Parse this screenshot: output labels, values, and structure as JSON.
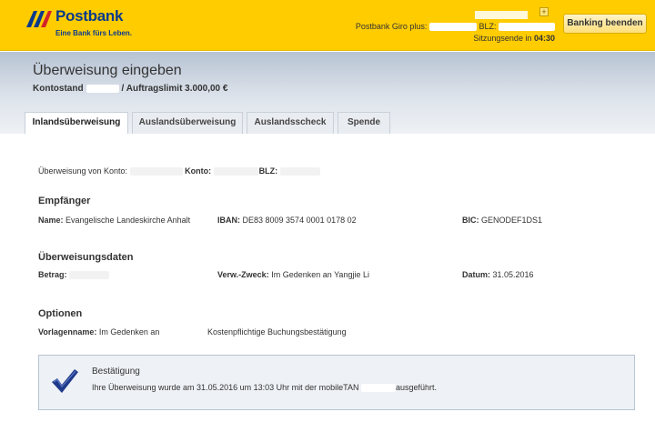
{
  "header": {
    "brand": "Postbank",
    "claim": "Eine Bank fürs Leben.",
    "account_label": "Postbank Giro plus:",
    "blz_label": "BLZ:",
    "session_label": "Sitzungsende in",
    "session_time": "04:30",
    "plus_symbol": "+",
    "logout_label": "Banking beenden"
  },
  "page": {
    "title": "Überweisung eingeben",
    "balance_label": "Kontostand",
    "limit_text": "/ Auftragslimit 3.000,00 €"
  },
  "tabs": [
    {
      "label": "Inlandsüberweisung",
      "active": true
    },
    {
      "label": "Auslandsüberweisung",
      "active": false
    },
    {
      "label": "Auslandsscheck",
      "active": false
    },
    {
      "label": "Spende",
      "active": false
    }
  ],
  "source": {
    "label": "Überweisung von Konto:",
    "konto_label": "Konto:",
    "blz_label": "BLZ:"
  },
  "recipient": {
    "heading": "Empfänger",
    "name_label": "Name:",
    "name_value": "Evangelische Landeskirche Anhalt",
    "iban_label": "IBAN:",
    "iban_value": "DE83 8009 3574 0001 0178 02",
    "bic_label": "BIC:",
    "bic_value": "GENODEF1DS1"
  },
  "transfer": {
    "heading": "Überweisungsdaten",
    "amount_label": "Betrag:",
    "purpose_label": "Verw.-Zweck:",
    "purpose_value": "Im Gedenken an Yangjie Li",
    "date_label": "Datum:",
    "date_value": "31.05.2016"
  },
  "options": {
    "heading": "Optionen",
    "template_label": "Vorlagenname:",
    "template_value": "Im Gedenken an",
    "receipt_text": "Kostenpflichtige Buchungsbestätigung"
  },
  "confirmation": {
    "title": "Bestätigung",
    "text_before": "Ihre Überweisung wurde am 31.05.2016 um 13:03 Uhr mit der mobileTAN",
    "text_after": "ausgeführt.",
    "check_icon": "checkmark-icon"
  },
  "colors": {
    "brand_yellow": "#ffcc00",
    "brand_blue": "#0a3a8c",
    "check_blue": "#1f3a8a"
  }
}
